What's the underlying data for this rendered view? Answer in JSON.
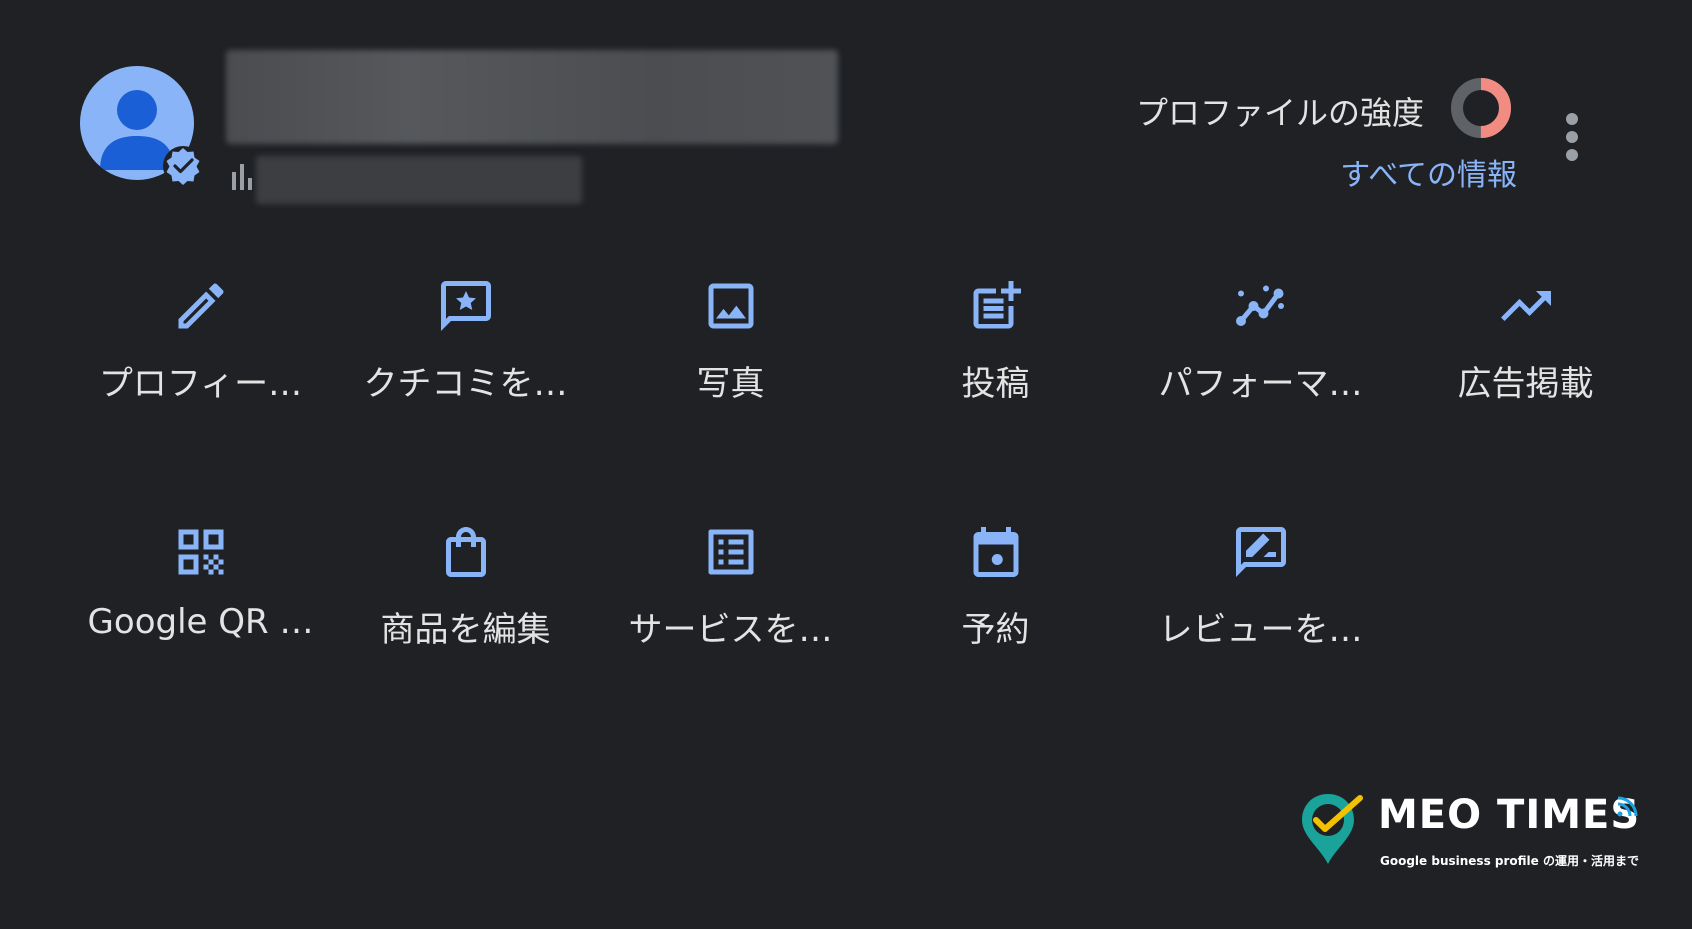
{
  "header": {
    "profile_strength_label": "プロファイルの強度",
    "profile_strength_fraction": 0.5,
    "all_info_link": "すべての情報"
  },
  "colors": {
    "background": "#1f2125",
    "accent": "#8ab4f8",
    "strength_ring_fill": "#f28b82",
    "strength_ring_track": "#5f6368"
  },
  "actions": [
    {
      "label": "プロフィー…",
      "icon": "pencil-icon"
    },
    {
      "label": "クチコミを…",
      "icon": "review-star-icon"
    },
    {
      "label": "写真",
      "icon": "photo-icon"
    },
    {
      "label": "投稿",
      "icon": "post-add-icon"
    },
    {
      "label": "パフォーマ…",
      "icon": "performance-icon"
    },
    {
      "label": "広告掲載",
      "icon": "trending-up-icon"
    },
    {
      "label": "Google QR …",
      "icon": "qr-code-icon"
    },
    {
      "label": "商品を編集",
      "icon": "shopping-bag-icon"
    },
    {
      "label": "サービスを…",
      "icon": "list-icon"
    },
    {
      "label": "予約",
      "icon": "calendar-icon"
    },
    {
      "label": "レビューを…",
      "icon": "rate-review-icon"
    }
  ],
  "watermark": {
    "title": "MEO TIMES",
    "subtitle": "Google business profile の運用・活用まで"
  }
}
